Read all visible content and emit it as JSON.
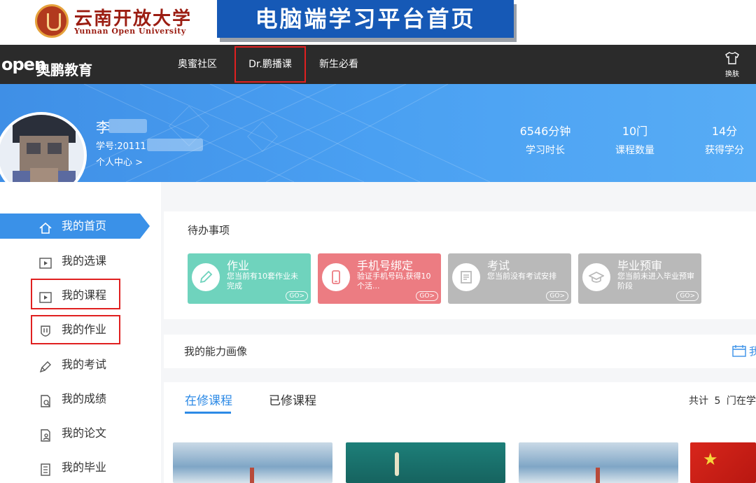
{
  "banner": {
    "university_cn": "云南开放大学",
    "university_en": "Yunnan Open University",
    "title": "电脑端学习平台首页"
  },
  "navbar": {
    "brand_logo": "open",
    "brand_name": "奥鹏教育",
    "items": [
      {
        "label": "奥蜜社区"
      },
      {
        "label": "Dr.鹏播课",
        "highlighted": true
      },
      {
        "label": "新生必看"
      }
    ],
    "skin_label": "换肤",
    "skin_icon": "shirt-icon"
  },
  "profile": {
    "name": "李",
    "student_id": "学号:20111",
    "personal_center": "个人中心 >",
    "stats": [
      {
        "value": "6546分钟",
        "label": "学习时长"
      },
      {
        "value": "10门",
        "label": "课程数量"
      },
      {
        "value": "14分",
        "label": "获得学分"
      }
    ]
  },
  "sidebar": {
    "items": [
      {
        "label": "我的首页",
        "icon": "home-icon",
        "active": true
      },
      {
        "label": "我的选课",
        "icon": "play-square-icon"
      },
      {
        "label": "我的课程",
        "icon": "play-square-icon",
        "highlighted": true
      },
      {
        "label": "我的作业",
        "icon": "bookmark-icon",
        "highlighted": true
      },
      {
        "label": "我的考试",
        "icon": "pen-icon"
      },
      {
        "label": "我的成绩",
        "icon": "report-icon"
      },
      {
        "label": "我的论文",
        "icon": "paper-user-icon"
      },
      {
        "label": "我的毕业",
        "icon": "list-doc-icon"
      }
    ]
  },
  "todo": {
    "title": "待办事项",
    "cards": [
      {
        "title": "作业",
        "desc": "您当前有10套作业未完成",
        "go": "GO>",
        "color": "#6fd3bd",
        "icon": "pencil-icon"
      },
      {
        "title": "手机号绑定",
        "desc": "验证手机号码,获得10个活...",
        "go": "GO>",
        "color": "#ec7c82",
        "icon": "phone-icon"
      },
      {
        "title": "考试",
        "desc": "您当前没有考试安排",
        "go": "GO>",
        "color": "#b9b9b9",
        "icon": "document-icon"
      },
      {
        "title": "毕业预审",
        "desc": "您当前未进入毕业预审阶段",
        "go": "GO>",
        "color": "#b9b9b9",
        "icon": "graduation-cap-icon"
      }
    ]
  },
  "ability": {
    "title": "我的能力画像",
    "calendar_fragment": "我"
  },
  "courses": {
    "tabs": [
      {
        "label": "在修课程",
        "active": true
      },
      {
        "label": "已修课程"
      }
    ],
    "count_prefix": "共计",
    "count_value": "5",
    "count_suffix": "门在学"
  },
  "colors": {
    "nav_bg": "#2b2b2b",
    "header_blue": "#4aa0f2",
    "active_blue": "#3a91e8",
    "highlight_red": "#e02020",
    "banner_blue": "#1659b6",
    "university_red": "#9b1d12"
  }
}
